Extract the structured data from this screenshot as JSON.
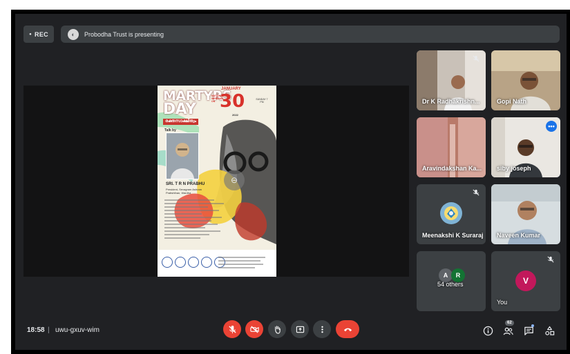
{
  "recording": {
    "label": "REC"
  },
  "presenting": {
    "text": "Probodha Trust is presenting"
  },
  "poster": {
    "title_line1": "MARTYRS",
    "title_line2": "DAY",
    "month": "JANUARY",
    "day": "30",
    "event_type": "NATIONAL WEBINAR ON",
    "year": "2022",
    "time": "SUNDAY 7 PM",
    "malayalam_tag": "രക്തസാക്ഷിത്വം",
    "talk_by": "Talk by",
    "speaker_name": "SRI. T R N PRABHU",
    "speaker_role": "President, Sevagram Ashram Pratishthan, Wardha"
  },
  "participants": [
    {
      "name": "Dr K Radhakrishn...",
      "muted": true
    },
    {
      "name": "Gopi Nath",
      "muted": false
    },
    {
      "name": "Aravindakshan Ka...",
      "muted": false
    },
    {
      "name": "siby joseph",
      "muted": false,
      "active": true
    },
    {
      "name": "Meenakshi K Suraraj",
      "muted": true
    },
    {
      "name": "Naveen Kumar",
      "muted": false
    },
    {
      "name": "54 others",
      "avatars": [
        "A",
        "R"
      ]
    },
    {
      "name": "You",
      "avatar": "V",
      "muted": true
    }
  ],
  "colors": {
    "background": "#202124",
    "tile": "#3c4043",
    "active_outline": "#8ab4f8",
    "end_call": "#ea4335",
    "avatar_a": "#5f6368",
    "avatar_r": "#137333",
    "avatar_v": "#c2185b"
  },
  "bottom_bar": {
    "time": "18:58",
    "separator": "|",
    "meeting_code": "uwu-gxuv-wim",
    "people_count": "62",
    "icons": [
      "mic-off-icon",
      "camera-off-icon",
      "raise-hand-icon",
      "present-icon",
      "more-options-icon",
      "end-call-icon",
      "info-icon",
      "people-icon",
      "chat-icon",
      "activities-icon"
    ]
  }
}
